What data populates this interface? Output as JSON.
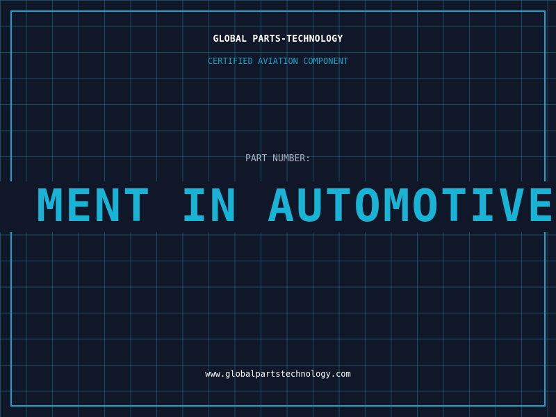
{
  "header": {
    "brand": "GLOBAL PARTS-TECHNOLOGY",
    "tagline": "CERTIFIED AVIATION COMPONENT"
  },
  "part": {
    "label": "PART NUMBER:",
    "scrolling_text": "MENT IN AUTOMOTIVE"
  },
  "footer": {
    "website": "www.globalpartstechnology.com"
  },
  "colors": {
    "background": "#0f1729",
    "grid": "#2896aa",
    "accent": "#1aa3c8",
    "banner_text": "#19b3d6",
    "label": "#a8b3c4",
    "text": "#ffffff"
  }
}
